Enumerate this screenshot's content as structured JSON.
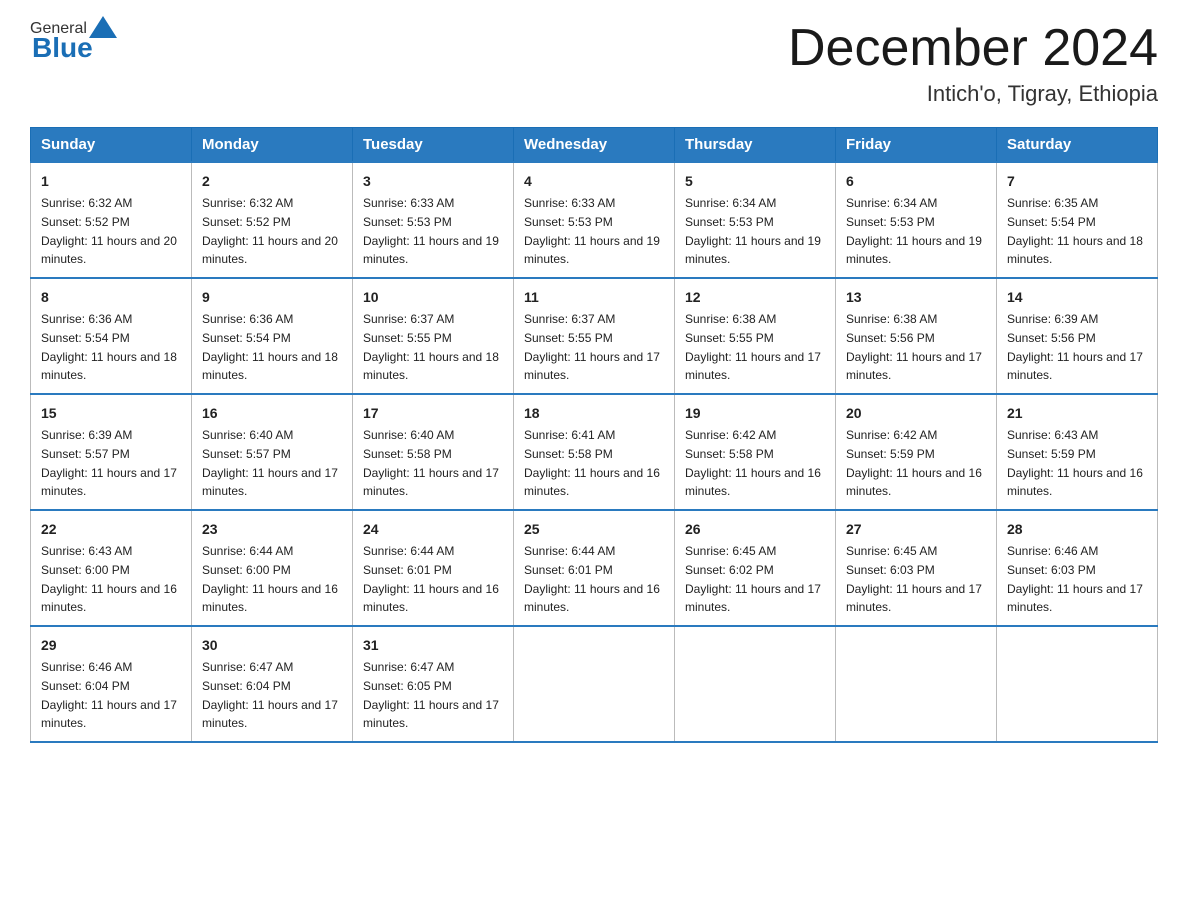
{
  "header": {
    "logo_general": "General",
    "logo_blue": "Blue",
    "month_title": "December 2024",
    "location": "Intich'o, Tigray, Ethiopia"
  },
  "weekdays": [
    "Sunday",
    "Monday",
    "Tuesday",
    "Wednesday",
    "Thursday",
    "Friday",
    "Saturday"
  ],
  "weeks": [
    [
      {
        "day": "1",
        "sunrise": "6:32 AM",
        "sunset": "5:52 PM",
        "daylight": "11 hours and 20 minutes."
      },
      {
        "day": "2",
        "sunrise": "6:32 AM",
        "sunset": "5:52 PM",
        "daylight": "11 hours and 20 minutes."
      },
      {
        "day": "3",
        "sunrise": "6:33 AM",
        "sunset": "5:53 PM",
        "daylight": "11 hours and 19 minutes."
      },
      {
        "day": "4",
        "sunrise": "6:33 AM",
        "sunset": "5:53 PM",
        "daylight": "11 hours and 19 minutes."
      },
      {
        "day": "5",
        "sunrise": "6:34 AM",
        "sunset": "5:53 PM",
        "daylight": "11 hours and 19 minutes."
      },
      {
        "day": "6",
        "sunrise": "6:34 AM",
        "sunset": "5:53 PM",
        "daylight": "11 hours and 19 minutes."
      },
      {
        "day": "7",
        "sunrise": "6:35 AM",
        "sunset": "5:54 PM",
        "daylight": "11 hours and 18 minutes."
      }
    ],
    [
      {
        "day": "8",
        "sunrise": "6:36 AM",
        "sunset": "5:54 PM",
        "daylight": "11 hours and 18 minutes."
      },
      {
        "day": "9",
        "sunrise": "6:36 AM",
        "sunset": "5:54 PM",
        "daylight": "11 hours and 18 minutes."
      },
      {
        "day": "10",
        "sunrise": "6:37 AM",
        "sunset": "5:55 PM",
        "daylight": "11 hours and 18 minutes."
      },
      {
        "day": "11",
        "sunrise": "6:37 AM",
        "sunset": "5:55 PM",
        "daylight": "11 hours and 17 minutes."
      },
      {
        "day": "12",
        "sunrise": "6:38 AM",
        "sunset": "5:55 PM",
        "daylight": "11 hours and 17 minutes."
      },
      {
        "day": "13",
        "sunrise": "6:38 AM",
        "sunset": "5:56 PM",
        "daylight": "11 hours and 17 minutes."
      },
      {
        "day": "14",
        "sunrise": "6:39 AM",
        "sunset": "5:56 PM",
        "daylight": "11 hours and 17 minutes."
      }
    ],
    [
      {
        "day": "15",
        "sunrise": "6:39 AM",
        "sunset": "5:57 PM",
        "daylight": "11 hours and 17 minutes."
      },
      {
        "day": "16",
        "sunrise": "6:40 AM",
        "sunset": "5:57 PM",
        "daylight": "11 hours and 17 minutes."
      },
      {
        "day": "17",
        "sunrise": "6:40 AM",
        "sunset": "5:58 PM",
        "daylight": "11 hours and 17 minutes."
      },
      {
        "day": "18",
        "sunrise": "6:41 AM",
        "sunset": "5:58 PM",
        "daylight": "11 hours and 16 minutes."
      },
      {
        "day": "19",
        "sunrise": "6:42 AM",
        "sunset": "5:58 PM",
        "daylight": "11 hours and 16 minutes."
      },
      {
        "day": "20",
        "sunrise": "6:42 AM",
        "sunset": "5:59 PM",
        "daylight": "11 hours and 16 minutes."
      },
      {
        "day": "21",
        "sunrise": "6:43 AM",
        "sunset": "5:59 PM",
        "daylight": "11 hours and 16 minutes."
      }
    ],
    [
      {
        "day": "22",
        "sunrise": "6:43 AM",
        "sunset": "6:00 PM",
        "daylight": "11 hours and 16 minutes."
      },
      {
        "day": "23",
        "sunrise": "6:44 AM",
        "sunset": "6:00 PM",
        "daylight": "11 hours and 16 minutes."
      },
      {
        "day": "24",
        "sunrise": "6:44 AM",
        "sunset": "6:01 PM",
        "daylight": "11 hours and 16 minutes."
      },
      {
        "day": "25",
        "sunrise": "6:44 AM",
        "sunset": "6:01 PM",
        "daylight": "11 hours and 16 minutes."
      },
      {
        "day": "26",
        "sunrise": "6:45 AM",
        "sunset": "6:02 PM",
        "daylight": "11 hours and 17 minutes."
      },
      {
        "day": "27",
        "sunrise": "6:45 AM",
        "sunset": "6:03 PM",
        "daylight": "11 hours and 17 minutes."
      },
      {
        "day": "28",
        "sunrise": "6:46 AM",
        "sunset": "6:03 PM",
        "daylight": "11 hours and 17 minutes."
      }
    ],
    [
      {
        "day": "29",
        "sunrise": "6:46 AM",
        "sunset": "6:04 PM",
        "daylight": "11 hours and 17 minutes."
      },
      {
        "day": "30",
        "sunrise": "6:47 AM",
        "sunset": "6:04 PM",
        "daylight": "11 hours and 17 minutes."
      },
      {
        "day": "31",
        "sunrise": "6:47 AM",
        "sunset": "6:05 PM",
        "daylight": "11 hours and 17 minutes."
      },
      null,
      null,
      null,
      null
    ]
  ],
  "labels": {
    "sunrise": "Sunrise:",
    "sunset": "Sunset:",
    "daylight": "Daylight:"
  }
}
